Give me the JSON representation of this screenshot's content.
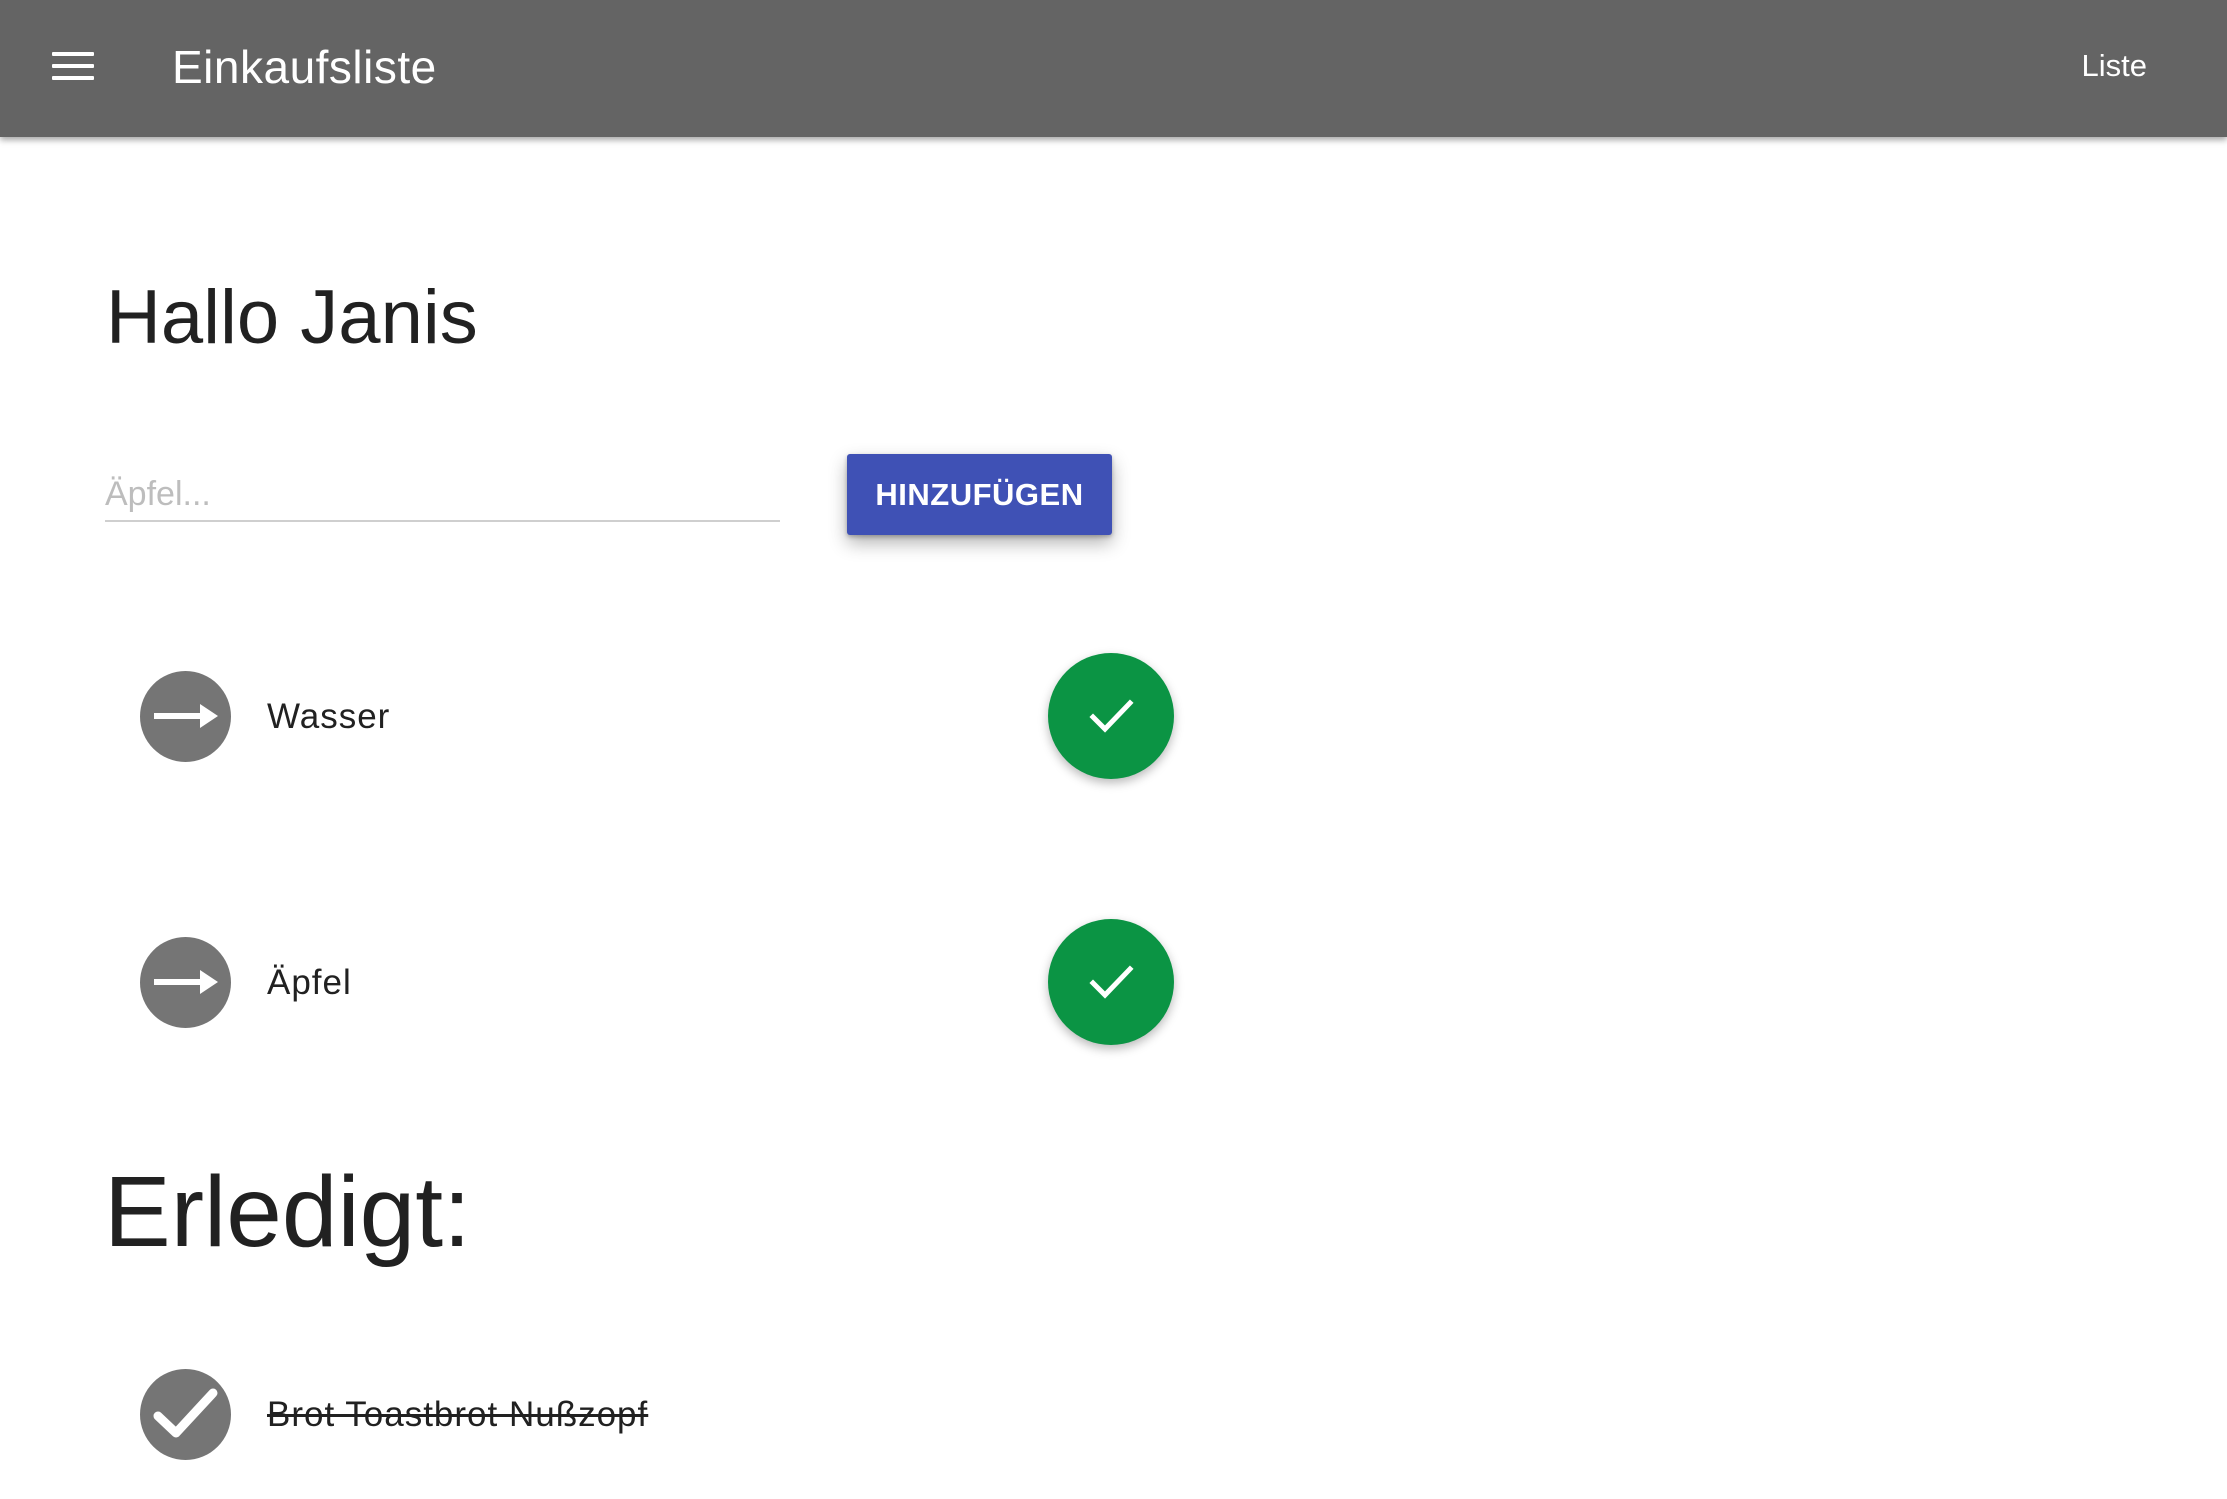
{
  "appbar": {
    "title": "Einkaufsliste",
    "nav_link": "Liste",
    "menu_icon": "menu-icon",
    "background": "#646464"
  },
  "main": {
    "greeting": "Hallo Janis",
    "input": {
      "placeholder": "Äpfel...",
      "value": ""
    },
    "add_button_label": "HINZUFÜGEN",
    "add_button_color": "#3f51b5",
    "open_items": [
      {
        "label": "Wasser",
        "icon": "arrow-right-icon",
        "action_icon": "check-icon"
      },
      {
        "label": "Äpfel",
        "icon": "arrow-right-icon",
        "action_icon": "check-icon"
      }
    ],
    "check_color": "#0b9444",
    "done_heading": "Erledigt:",
    "done_items": [
      {
        "label": "Brot Toastbrot Nußzopf",
        "icon": "check-circle-icon"
      }
    ]
  }
}
